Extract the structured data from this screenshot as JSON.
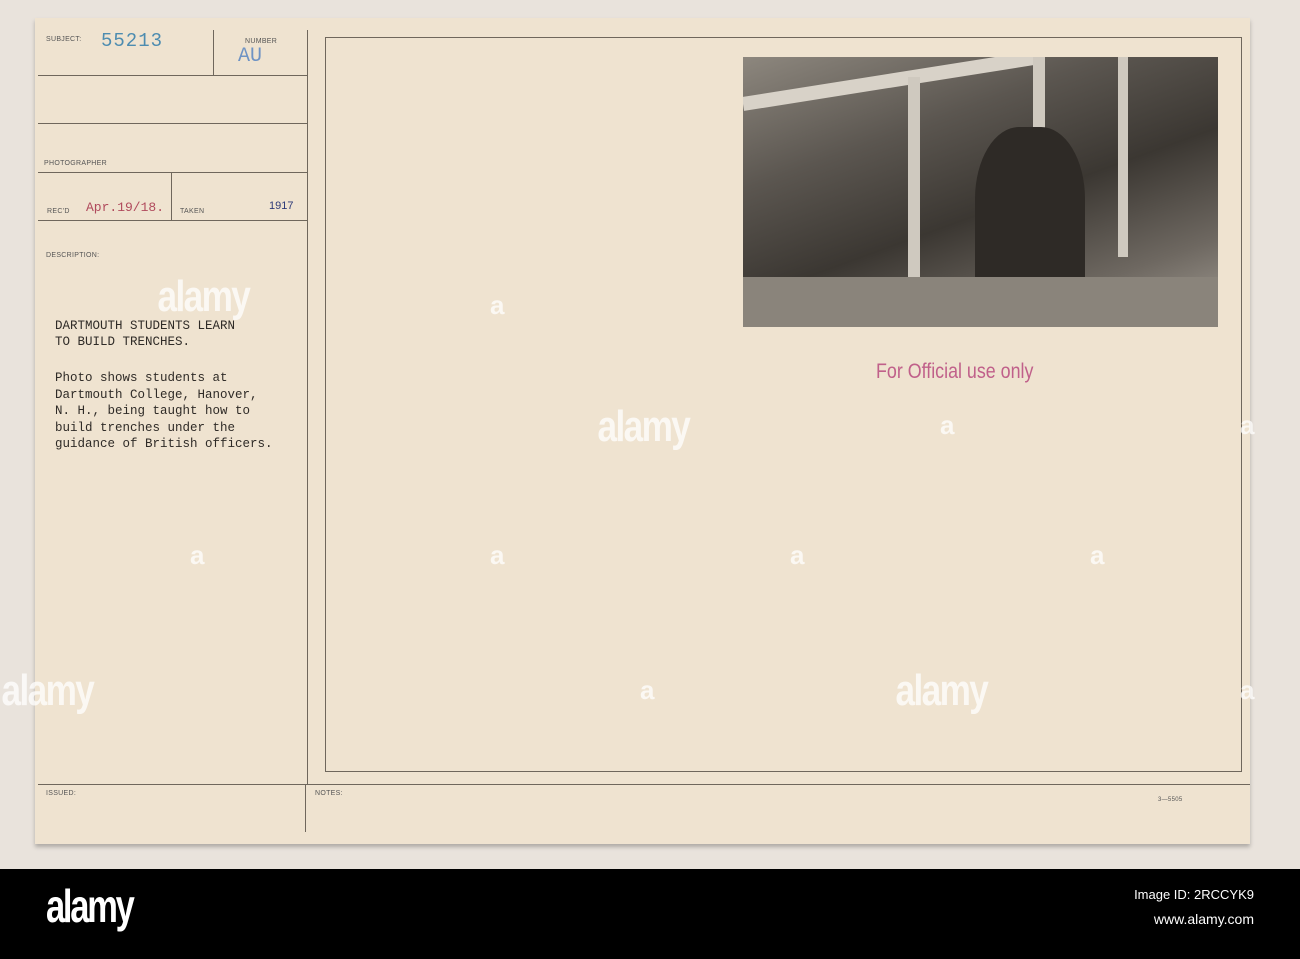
{
  "card": {
    "subject_label": "SUBJECT:",
    "subject_value": "55213",
    "number_label": "NUMBER",
    "number_value": "AU",
    "photographer_label": "PHOTOGRAPHER",
    "recd_label": "REC'D",
    "recd_value": "Apr.19/18.",
    "taken_label": "TAKEN",
    "taken_value": "1917",
    "description_label": "DESCRIPTION:",
    "title": "DARTMOUTH STUDENTS LEARN\nTO BUILD TRENCHES.",
    "body": "Photo shows students at\nDartmouth College, Hanover,\nN. H., being taught how to\nbuild trenches under the\nguidance of British officers.",
    "issued_label": "ISSUED:",
    "notes_label": "NOTES:",
    "form_number": "3—5505",
    "stamp": "For Official use only",
    "stamp_color": "#c0608a"
  },
  "watermark": {
    "text": "alamy",
    "letter": "a"
  },
  "footer": {
    "logo": "alamy",
    "image_id": "Image ID: 2RCCYK9",
    "url": "www.alamy.com"
  }
}
